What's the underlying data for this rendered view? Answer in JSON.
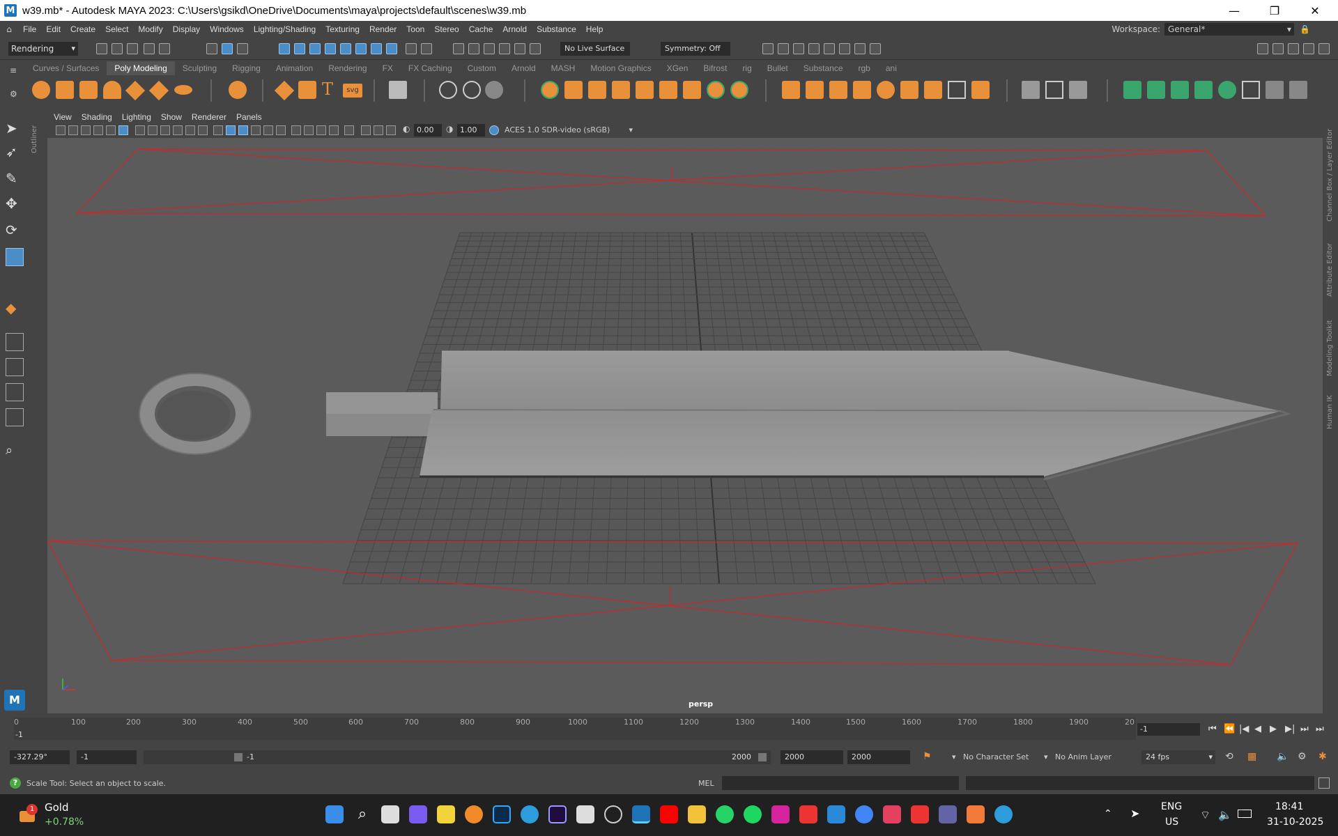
{
  "window": {
    "title": "w39.mb* - Autodesk MAYA 2023: C:\\Users\\gsikd\\OneDrive\\Documents\\maya\\projects\\default\\scenes\\w39.mb",
    "app_icon": "M"
  },
  "menu": [
    "File",
    "Edit",
    "Create",
    "Select",
    "Modify",
    "Display",
    "Windows",
    "Lighting/Shading",
    "Texturing",
    "Render",
    "Toon",
    "Stereo",
    "Cache",
    "Arnold",
    "Substance",
    "Help"
  ],
  "workspace": {
    "label": "Workspace:",
    "value": "General*"
  },
  "statusline": {
    "mode": "Rendering",
    "live_surface": "No Live Surface",
    "symmetry": "Symmetry: Off"
  },
  "shelf_tabs": [
    "Curves / Surfaces",
    "Poly Modeling",
    "Sculpting",
    "Rigging",
    "Animation",
    "Rendering",
    "FX",
    "FX Caching",
    "Custom",
    "Arnold",
    "MASH",
    "Motion Graphics",
    "XGen",
    "Bifrost",
    "rig",
    "Bullet",
    "Substance",
    "rgb",
    "ani"
  ],
  "active_shelf": "Poly Modeling",
  "shelf_text_icons": {
    "text_tool": "T",
    "svg_tool": "svg"
  },
  "outliner_label": "Outliner",
  "panel_menu": [
    "View",
    "Shading",
    "Lighting",
    "Show",
    "Renderer",
    "Panels"
  ],
  "panel_toolbar": {
    "exposure": "0.00",
    "gamma": "1.00",
    "color_space": "ACES 1.0 SDR-video (sRGB)"
  },
  "viewport": {
    "camera_label": "persp"
  },
  "right_tabs": [
    "Channel Box / Layer Editor",
    "Attribute Editor",
    "Modeling Toolkit",
    "Human IK"
  ],
  "timeline": {
    "ticks": [
      "0",
      "100",
      "200",
      "300",
      "400",
      "500",
      "600",
      "700",
      "800",
      "900",
      "1000",
      "1100",
      "1200",
      "1300",
      "1400",
      "1500",
      "1600",
      "1700",
      "1800",
      "1900",
      "20"
    ],
    "current_frame": "-1",
    "start_marker": "-1",
    "playback": [
      "⏮",
      "⏪",
      "|◀",
      "◀",
      "▶",
      "▶|",
      "⏭",
      "⏭"
    ]
  },
  "range": {
    "x_readout": "-327.29°",
    "start": "-1",
    "slider_start": "-1",
    "slider_end": "2000",
    "end": "2000",
    "anim_end": "2000",
    "character_set": "No Character Set",
    "anim_layer": "No Anim Layer",
    "fps": "24 fps"
  },
  "command": {
    "help_text": "Scale Tool: Select an object to scale.",
    "lang": "MEL"
  },
  "taskbar": {
    "widget_badge": "1",
    "widget_title": "Gold",
    "widget_value": "+0.78%",
    "lang_top": "ENG",
    "lang_bottom": "US",
    "time": "18:41",
    "date": "31-10-2025"
  },
  "colors": {
    "accent": "#4b8dc7",
    "poly_icon": "#e8913a",
    "light_frustum": "#e01e1e"
  }
}
